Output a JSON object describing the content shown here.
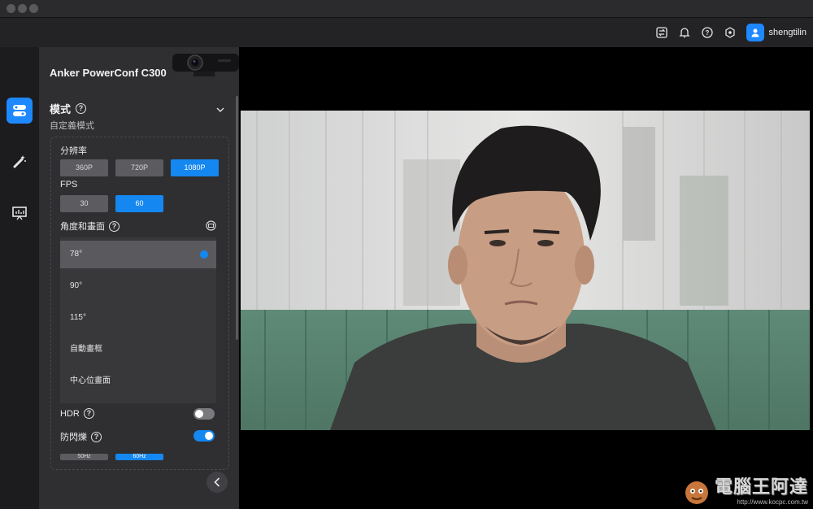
{
  "header": {
    "username": "shengtilin",
    "icons": [
      "swap-icon",
      "bell-icon",
      "help-icon",
      "settings-icon",
      "user-avatar-icon"
    ]
  },
  "nav": {
    "items": [
      "camera-settings-icon",
      "magic-wand-icon",
      "presentation-icon"
    ]
  },
  "panel": {
    "device_name": "Anker PowerConf C300",
    "mode": {
      "title": "模式",
      "subtitle": "自定義模式"
    },
    "resolution": {
      "label": "分辨率",
      "options": [
        "360P",
        "720P",
        "1080P"
      ],
      "selected": "1080P"
    },
    "fps": {
      "label": "FPS",
      "options": [
        "30",
        "60"
      ],
      "selected": "60"
    },
    "angle": {
      "label": "角度和畫面",
      "options": [
        "78°",
        "90°",
        "115°",
        "自動畫框",
        "中心位畫面"
      ],
      "selected": "78°"
    },
    "hdr": {
      "label": "HDR",
      "enabled": false
    },
    "antiflicker": {
      "label": "防閃爍",
      "enabled": true,
      "options": [
        "50Hz",
        "60Hz"
      ],
      "selected": "60Hz"
    }
  },
  "watermark": {
    "text": "電腦王阿達",
    "url": "http://www.kocpc.com.tw"
  },
  "colors": {
    "accent": "#1487f0",
    "panel": "#2f2f32",
    "background": "#1b1b1d"
  }
}
